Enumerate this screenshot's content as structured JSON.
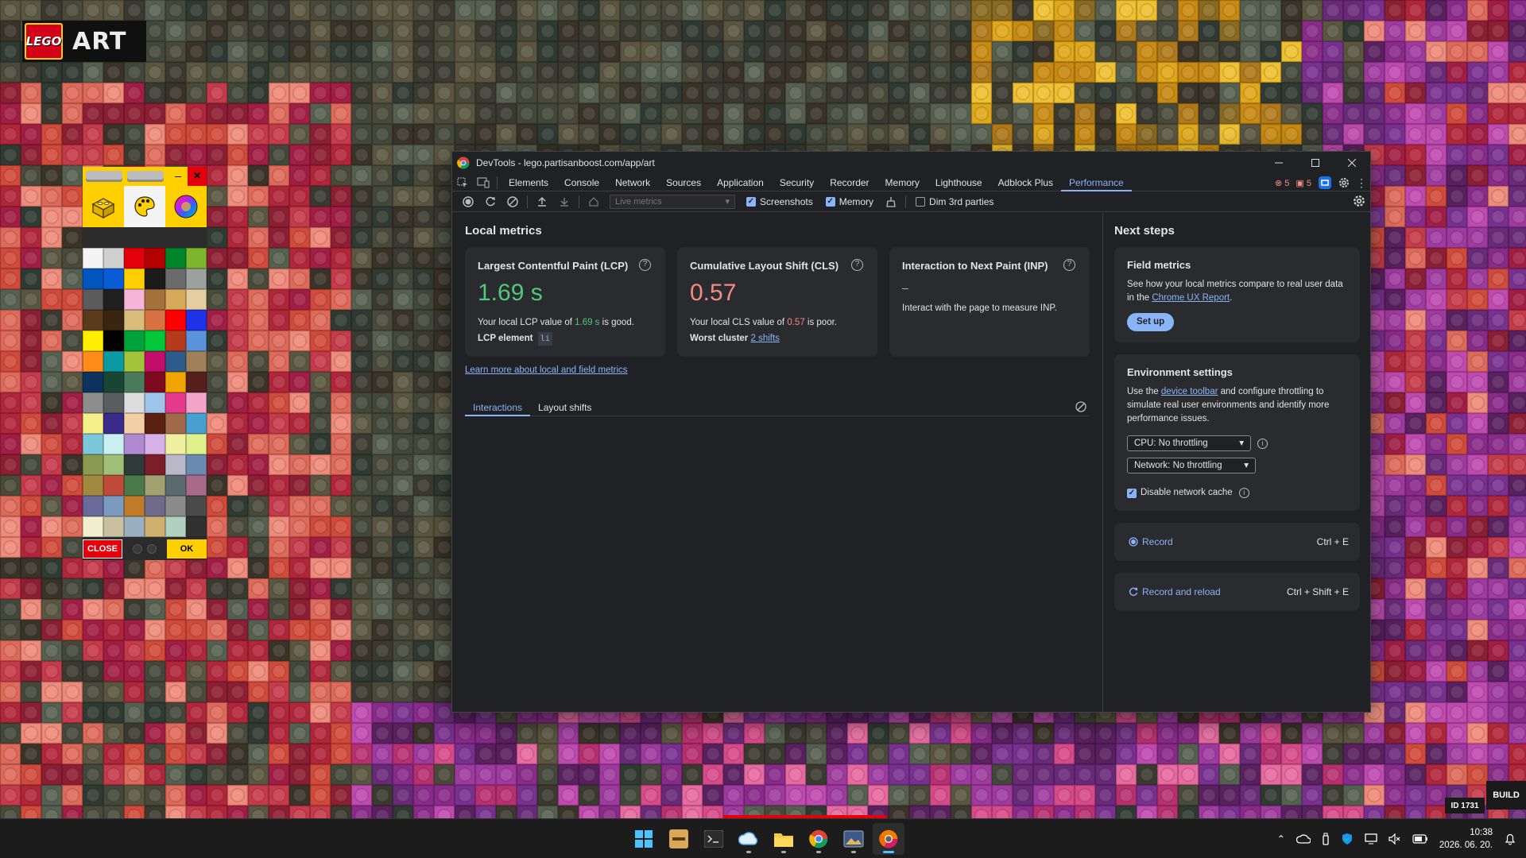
{
  "brand": {
    "lego_text": "LEGO",
    "art_text": "ART"
  },
  "palette_panel": {
    "close_label": "CLOSE",
    "ok_label": "OK",
    "minimize_glyph": "–",
    "close_glyph": "×",
    "modes": [
      "brick-icon",
      "palette-icon",
      "color-wheel-icon"
    ],
    "swatches": [
      "#f4f4f4",
      "#d0d0d0",
      "#e3000b",
      "#b40000",
      "#00852b",
      "#7bb62e",
      "#0055bf",
      "#0a5cd6",
      "#ffcf00",
      "#1b1b1b",
      "#6b6b6b",
      "#9ba19d",
      "#5b5b5b",
      "#202020",
      "#f6b4d8",
      "#a5713b",
      "#d6a95b",
      "#e4cd9e",
      "#5a3a1c",
      "#3a2510",
      "#d9bb7b",
      "#d67240",
      "#ff0000",
      "#1e32e8",
      "#ffee00",
      "#000000",
      "#00a33a",
      "#00c83a",
      "#b53a1b",
      "#5a93db",
      "#fe8a18",
      "#0b9aa1",
      "#a1c43a",
      "#c20e69",
      "#2e5c8a",
      "#a0805a",
      "#0d325b",
      "#184632",
      "#4b7a5a",
      "#7e0a1e",
      "#f0a400",
      "#56201a",
      "#8d8d8d",
      "#595d60",
      "#dcdcdc",
      "#9fc3e9",
      "#e5398c",
      "#f2a5c8",
      "#f6f08a",
      "#3a2a8a",
      "#f3cfa6",
      "#5a2010",
      "#a06a4a",
      "#48a0d0",
      "#7bc8dc",
      "#c8f0f0",
      "#b08ad0",
      "#d8b0e8",
      "#f0f0a0",
      "#e0f08a",
      "#8a9a50",
      "#a0c07a",
      "#303a3a",
      "#7a1e2a",
      "#b8b8c8",
      "#6a8ab0",
      "#a08a40",
      "#c04a3a",
      "#4a7a4a",
      "#a0a070",
      "#5a6a70",
      "#a86a8a",
      "#6a6a9a",
      "#7a9ac0",
      "#c07a2a",
      "#706a8a",
      "#8a8a8a",
      "#4a4a4a",
      "#f0f0d0",
      "#c8c0a0",
      "#9ab0c0",
      "#d0b070",
      "#b0d0c0",
      "#303030"
    ]
  },
  "devtools": {
    "window_title": "DevTools - lego.partisanboost.com/app/art",
    "tabs": [
      "Elements",
      "Console",
      "Network",
      "Sources",
      "Application",
      "Security",
      "Recorder",
      "Memory",
      "Lighthouse",
      "Adblock Plus",
      "Performance"
    ],
    "active_tab": "Performance",
    "error_count": "5",
    "warning_count": "5",
    "toolbar": {
      "live_metrics_select": "Live metrics",
      "screenshots_label": "Screenshots",
      "memory_label": "Memory",
      "dim_label": "Dim 3rd parties"
    },
    "local_metrics": {
      "heading": "Local metrics",
      "lcp": {
        "title": "Largest Contentful Paint (LCP)",
        "value": "1.69 s",
        "desc_prefix": "Your local LCP value of ",
        "desc_value": "1.69 s",
        "desc_suffix": " is good.",
        "element_label": "LCP element",
        "element_node": "li"
      },
      "cls": {
        "title": "Cumulative Layout Shift (CLS)",
        "value": "0.57",
        "desc_prefix": "Your local CLS value of ",
        "desc_value": "0.57",
        "desc_suffix": " is poor.",
        "cluster_label": "Worst cluster",
        "cluster_link": "2 shifts"
      },
      "inp": {
        "title": "Interaction to Next Paint (INP)",
        "value": "–",
        "desc": "Interact with the page to measure INP."
      },
      "learn_more": "Learn more about local and field metrics",
      "subtabs": [
        "Interactions",
        "Layout shifts"
      ]
    },
    "next_steps": {
      "heading": "Next steps",
      "field_metrics": {
        "title": "Field metrics",
        "text_1": "See how your local metrics compare to real user data in the ",
        "link": "Chrome UX Report",
        "text_2": ".",
        "button": "Set up"
      },
      "environment": {
        "title": "Environment settings",
        "text_1": "Use the ",
        "link": "device toolbar",
        "text_2": " and configure throttling to simulate real user environments and identify more performance issues.",
        "cpu": "CPU: No throttling",
        "network": "Network: No throttling",
        "cache_label": "Disable network cache"
      },
      "record": {
        "label": "Record",
        "shortcut": "Ctrl + E"
      },
      "record_reload": {
        "label": "Record and reload",
        "shortcut": "Ctrl + Shift + E"
      }
    }
  },
  "overlay": {
    "build_label": "BUILD",
    "id_label": "ID 1731"
  },
  "taskbar": {
    "apps": [
      "windows-start-icon",
      "sonos-icon",
      "terminal-icon",
      "cloud-app-icon",
      "file-explorer-icon",
      "chrome-icon",
      "photos-icon",
      "chrome-dev-icon"
    ],
    "clock_time": "10:38",
    "clock_date": "2026. 06. 20."
  },
  "colors": {
    "accent": "#8ab4f8",
    "good": "#54c77b",
    "poor": "#f28b82",
    "lego_red": "#e3000b",
    "lego_yellow": "#ffcf00"
  }
}
